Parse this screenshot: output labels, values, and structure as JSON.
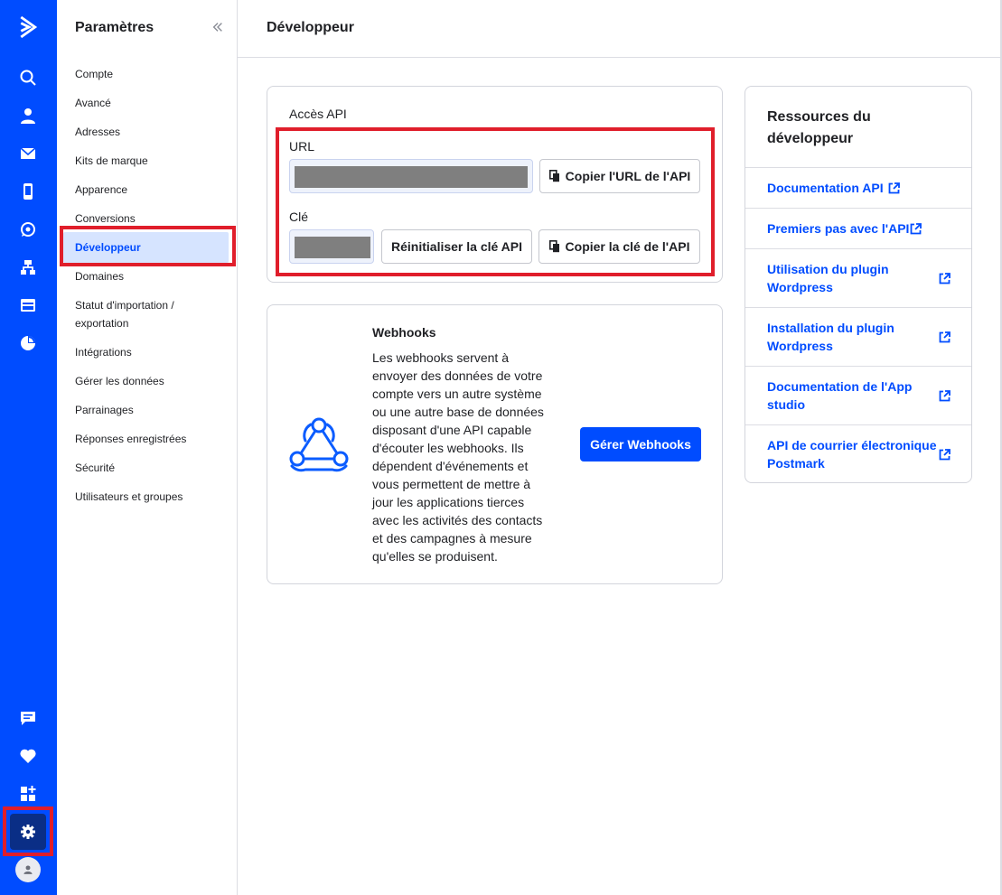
{
  "rail": {
    "icons": [
      "logo-icon",
      "search-icon",
      "contacts-icon",
      "email-icon",
      "sms-icon",
      "whatsapp-icon",
      "automations-icon",
      "site-icon",
      "reports-icon",
      "conversations-icon",
      "deals-icon",
      "apps-icon",
      "settings-icon",
      "user-avatar-icon"
    ]
  },
  "sidebar": {
    "title": "Paramètres",
    "items": [
      {
        "label": "Compte"
      },
      {
        "label": "Avancé"
      },
      {
        "label": "Adresses"
      },
      {
        "label": "Kits de marque"
      },
      {
        "label": "Apparence"
      },
      {
        "label": "Conversions"
      },
      {
        "label": "Développeur"
      },
      {
        "label": "Domaines"
      },
      {
        "label": "Statut d'importation / exportation"
      },
      {
        "label": "Intégrations"
      },
      {
        "label": "Gérer les données"
      },
      {
        "label": "Parrainages"
      },
      {
        "label": "Réponses enregistrées"
      },
      {
        "label": "Sécurité"
      },
      {
        "label": "Utilisateurs et groupes"
      }
    ],
    "active_index": 6
  },
  "header": {
    "title": "Développeur"
  },
  "api": {
    "section_title": "Accès API",
    "url_label": "URL",
    "copy_url_label": "Copier l'URL de l'API",
    "key_label": "Clé",
    "reset_key_label": "Réinitialiser la clé API",
    "copy_key_label": "Copier la clé de l'API"
  },
  "webhooks": {
    "title": "Webhooks",
    "description": "Les webhooks servent à envoyer des données de votre compte vers un autre système ou une autre base de données disposant d'une API capable d'écouter les webhooks. Ils dépendent d'événements et vous permettent de mettre à jour les applications tierces avec les activités des contacts et des campagnes à mesure qu'elles se produisent.",
    "button_label": "Gérer Webhooks"
  },
  "resources": {
    "title": "Ressources du développeur",
    "links": [
      {
        "label": "Documentation API"
      },
      {
        "label": "Premiers pas avec l'API"
      },
      {
        "label": "Utilisation du plugin Wordpress"
      },
      {
        "label": "Installation du plugin Wordpress"
      },
      {
        "label": "Documentation de l'App studio"
      },
      {
        "label": "API de courrier électronique Postmark"
      }
    ]
  },
  "colors": {
    "brand": "#004cff",
    "highlight": "#e01e2b",
    "active_bg": "#d6e4ff"
  }
}
